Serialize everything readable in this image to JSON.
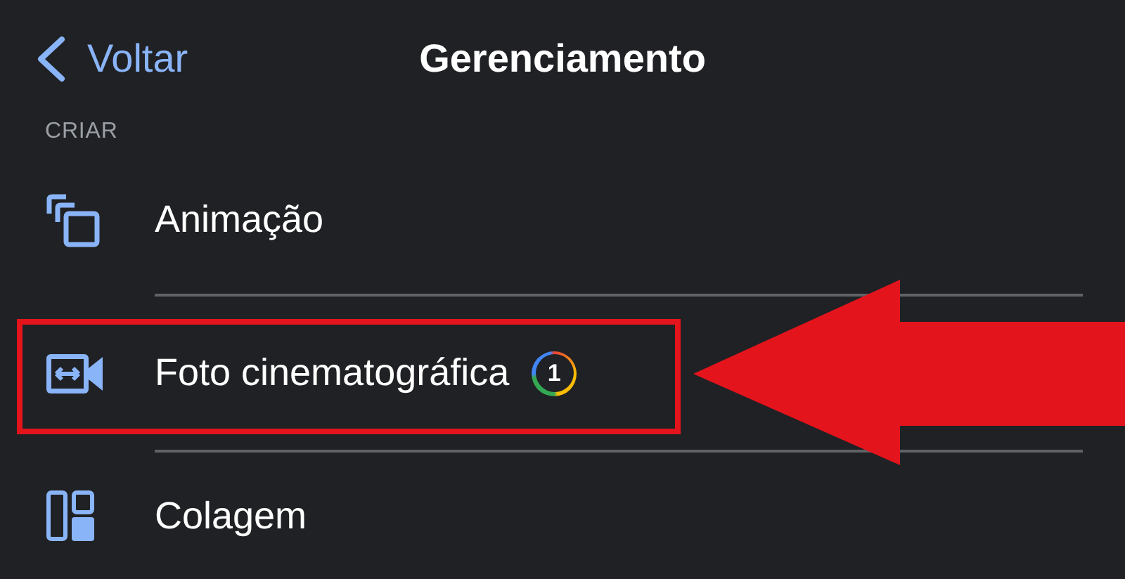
{
  "header": {
    "back_label": "Voltar",
    "title": "Gerenciamento"
  },
  "section": {
    "label": "CRIAR",
    "items": [
      {
        "kind": "animation",
        "label": "Animação",
        "highlighted": false
      },
      {
        "kind": "cinematic",
        "label": "Foto cinematográfica",
        "badge": "1",
        "highlighted": true
      },
      {
        "kind": "collage",
        "label": "Colagem",
        "highlighted": false
      }
    ]
  }
}
